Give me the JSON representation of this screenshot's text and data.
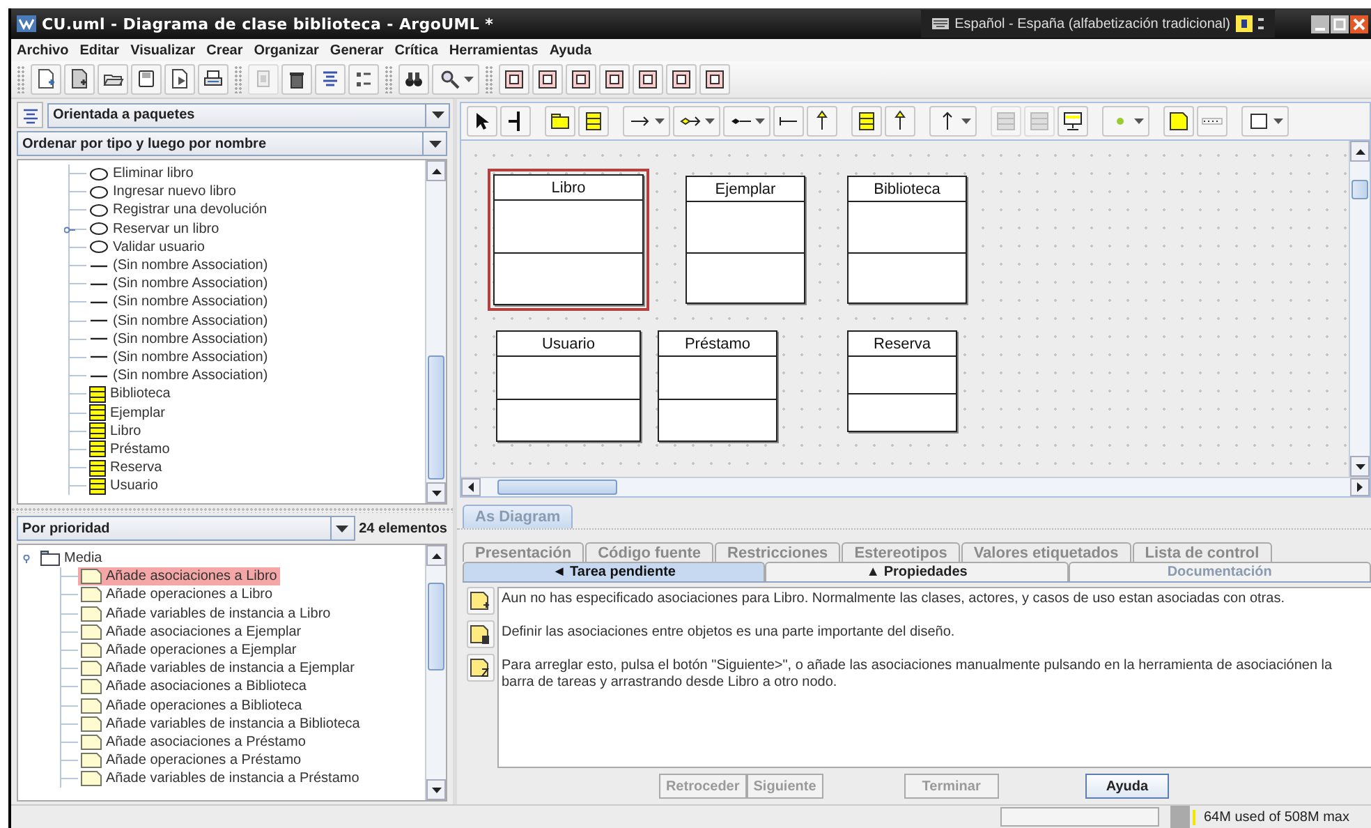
{
  "window": {
    "title": "CU.uml - Diagrama de clase biblioteca - ArgoUML *"
  },
  "language_bar": {
    "text": "Español - España (alfabetización tradicional)"
  },
  "menu": [
    "Archivo",
    "Editar",
    "Visualizar",
    "Crear",
    "Organizar",
    "Generar",
    "Crítica",
    "Herramientas",
    "Ayuda"
  ],
  "explorer": {
    "perspective": "Orientada a paquetes",
    "order": "Ordenar por tipo y luego por nombre",
    "items": [
      {
        "kind": "usecase",
        "label": "Eliminar libro",
        "expandable": false
      },
      {
        "kind": "usecase",
        "label": "Ingresar nuevo libro",
        "expandable": false
      },
      {
        "kind": "usecase",
        "label": "Registrar una devolución",
        "expandable": false
      },
      {
        "kind": "usecase",
        "label": "Reservar un libro",
        "expandable": true
      },
      {
        "kind": "usecase",
        "label": "Validar usuario",
        "expandable": false
      },
      {
        "kind": "association",
        "label": "(Sin nombre Association)",
        "expandable": false
      },
      {
        "kind": "association",
        "label": "(Sin nombre Association)",
        "expandable": false
      },
      {
        "kind": "association",
        "label": "(Sin nombre Association)",
        "expandable": false
      },
      {
        "kind": "association",
        "label": "(Sin nombre Association)",
        "expandable": false
      },
      {
        "kind": "association",
        "label": "(Sin nombre Association)",
        "expandable": false
      },
      {
        "kind": "association",
        "label": "(Sin nombre Association)",
        "expandable": false
      },
      {
        "kind": "association",
        "label": "(Sin nombre Association)",
        "expandable": false
      },
      {
        "kind": "class",
        "label": "Biblioteca",
        "expandable": false
      },
      {
        "kind": "class",
        "label": "Ejemplar",
        "expandable": false
      },
      {
        "kind": "class",
        "label": "Libro",
        "expandable": false
      },
      {
        "kind": "class",
        "label": "Préstamo",
        "expandable": false
      },
      {
        "kind": "class",
        "label": "Reserva",
        "expandable": false
      },
      {
        "kind": "class",
        "label": "Usuario",
        "expandable": false
      }
    ]
  },
  "todo": {
    "filter": "Por prioridad",
    "count": "24 elementos",
    "groups": [
      {
        "label": "Media",
        "expanded": true,
        "children": [
          {
            "label": "Añade asociaciones a Libro",
            "selected": true
          },
          {
            "label": "Añade operaciones a Libro",
            "selected": false
          },
          {
            "label": "Añade variables de instancia a Libro",
            "selected": false
          },
          {
            "label": "Añade asociaciones a Ejemplar",
            "selected": false
          },
          {
            "label": "Añade operaciones a Ejemplar",
            "selected": false
          },
          {
            "label": "Añade variables de instancia a Ejemplar",
            "selected": false
          },
          {
            "label": "Añade asociaciones a Biblioteca",
            "selected": false
          },
          {
            "label": "Añade operaciones a Biblioteca",
            "selected": false
          },
          {
            "label": "Añade variables de instancia a Biblioteca",
            "selected": false
          },
          {
            "label": "Añade asociaciones a Préstamo",
            "selected": false
          },
          {
            "label": "Añade operaciones a Préstamo",
            "selected": false
          },
          {
            "label": "Añade variables de instancia a Préstamo",
            "selected": false
          }
        ]
      }
    ]
  },
  "diagram": {
    "tab": "As Diagram",
    "classes": [
      {
        "name": "Libro",
        "selected": true
      },
      {
        "name": "Ejemplar",
        "selected": false
      },
      {
        "name": "Biblioteca",
        "selected": false
      },
      {
        "name": "Usuario",
        "selected": false
      },
      {
        "name": "Préstamo",
        "selected": false
      },
      {
        "name": "Reserva",
        "selected": false
      }
    ]
  },
  "details": {
    "tabs": [
      {
        "label": "Presentación",
        "disabled": true
      },
      {
        "label": "Código fuente",
        "disabled": true
      },
      {
        "label": "Restricciones",
        "disabled": true
      },
      {
        "label": "Estereotipos",
        "disabled": true
      },
      {
        "label": "Valores etiquetados",
        "disabled": true
      },
      {
        "label": "Lista de control",
        "disabled": true
      }
    ],
    "panels": [
      {
        "label": "◄ Tarea pendiente",
        "selected": true,
        "disabled": false
      },
      {
        "label": "▲ Propiedades",
        "selected": false,
        "disabled": false
      },
      {
        "label": "Documentación",
        "selected": false,
        "disabled": true
      }
    ],
    "paragraphs": [
      "Aun no has especificado asociaciones para Libro. Normalmente las clases, actores, y casos de uso estan asociadas con otras.",
      "Definir las asociaciones entre objetos es una parte importante del diseño.",
      "Para arreglar esto, pulsa el botón \"Siguiente>\", o añade las asociaciones manualmente pulsando en la herramienta de asociaciónen la barra de tareas y arrastrando desde Libro a otro nodo."
    ],
    "buttons": [
      {
        "label": "Retroceder",
        "disabled": true
      },
      {
        "label": "Siguiente",
        "disabled": true
      },
      {
        "label": "Terminar",
        "disabled": true
      },
      {
        "label": "Ayuda",
        "disabled": false
      }
    ]
  },
  "status_bar": {
    "memory": "64M used of 508M max"
  }
}
